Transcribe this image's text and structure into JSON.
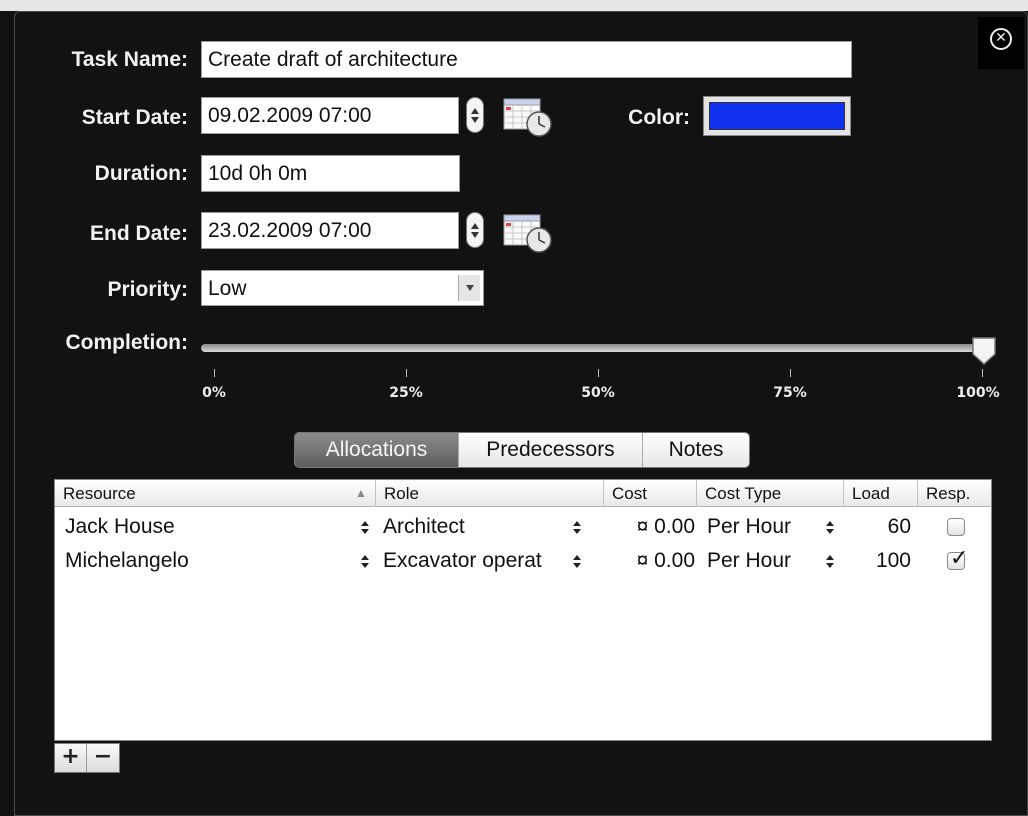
{
  "form": {
    "task_name_label": "Task Name:",
    "task_name_value": "Create draft of architecture",
    "start_date_label": "Start Date:",
    "start_date_value": "09.02.2009 07:00",
    "color_label": "Color:",
    "color_value": "#1030f0",
    "duration_label": "Duration:",
    "duration_value": "10d 0h 0m",
    "end_date_label": "End Date:",
    "end_date_value": "23.02.2009 07:00",
    "priority_label": "Priority:",
    "priority_value": "Low",
    "completion_label": "Completion:",
    "completion_value": 1.0,
    "completion_ticks": [
      "0%",
      "25%",
      "50%",
      "75%",
      "100%"
    ]
  },
  "close_icon": "close-circle-icon",
  "tabs": [
    {
      "label": "Allocations",
      "active": true
    },
    {
      "label": "Predecessors",
      "active": false
    },
    {
      "label": "Notes",
      "active": false
    }
  ],
  "table": {
    "columns": [
      "Resource",
      "Role",
      "Cost",
      "Cost Type",
      "Load",
      "Resp."
    ],
    "sort_indicator": "▲",
    "rows": [
      {
        "resource": "Jack House",
        "role": "Architect",
        "cost": "¤ 0.00",
        "cost_type": "Per Hour",
        "load": "60",
        "resp": false
      },
      {
        "resource": "Michelangelo",
        "role": "Excavator operat",
        "cost": "¤ 0.00",
        "cost_type": "Per Hour",
        "load": "100",
        "resp": true
      }
    ]
  },
  "buttons": {
    "add": "+",
    "remove": "−"
  }
}
